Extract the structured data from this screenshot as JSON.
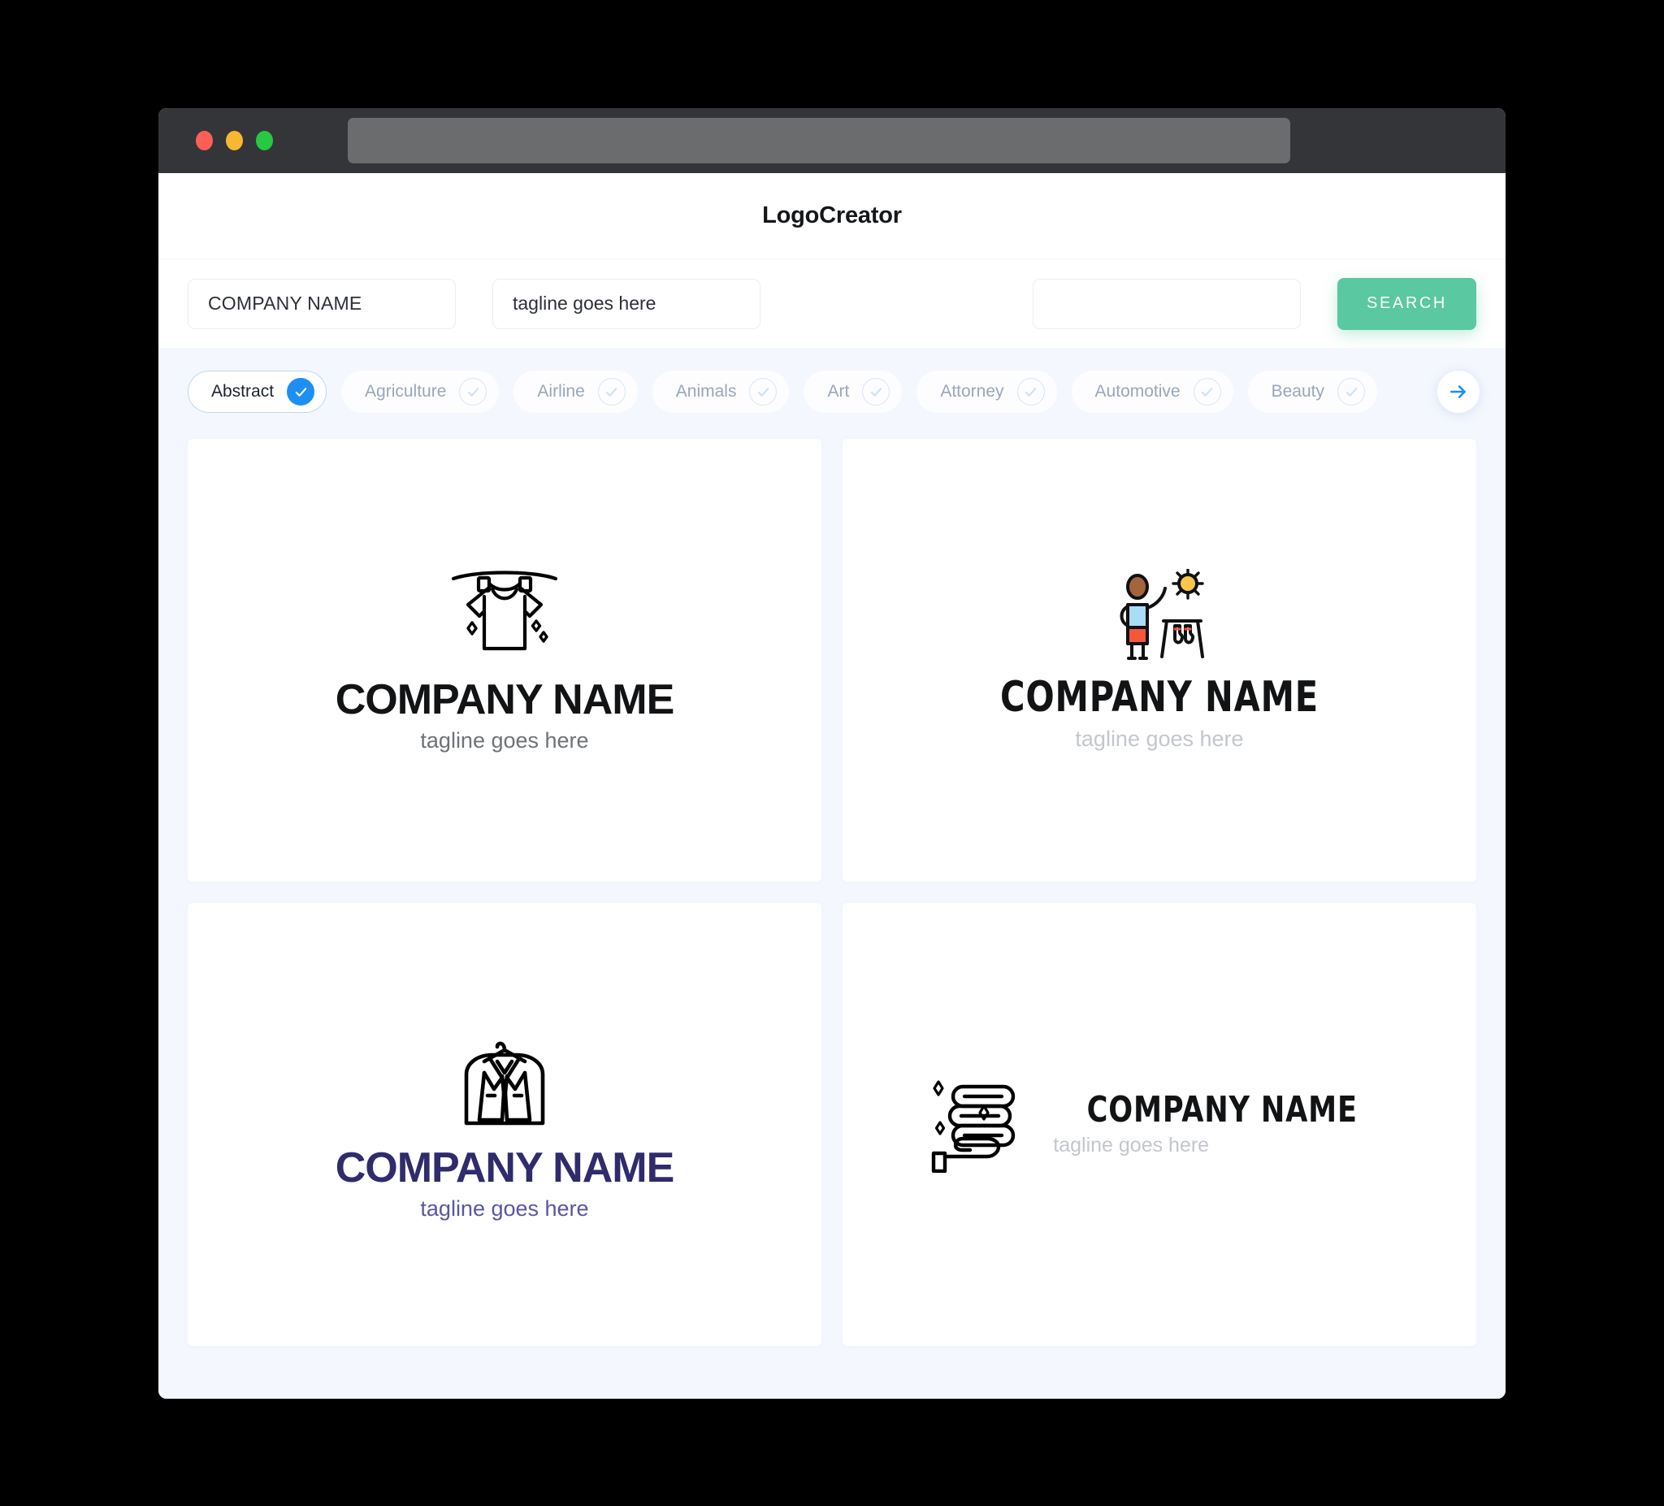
{
  "window": {
    "traffic_lights": [
      "close",
      "minimize",
      "maximize"
    ],
    "url_value": ""
  },
  "header": {
    "app_title": "LogoCreator"
  },
  "search": {
    "company_value": "COMPANY NAME",
    "company_placeholder": "COMPANY NAME",
    "tagline_value": "tagline goes here",
    "tagline_placeholder": "tagline goes here",
    "extra_value": "",
    "extra_placeholder": "",
    "search_button": "SEARCH",
    "search_button_color": "#5ac8a0"
  },
  "categories": {
    "next_icon": "arrow-right-icon",
    "accent_color": "#1d8ff2",
    "items": [
      {
        "label": "Abstract",
        "selected": true
      },
      {
        "label": "Agriculture",
        "selected": false
      },
      {
        "label": "Airline",
        "selected": false
      },
      {
        "label": "Animals",
        "selected": false
      },
      {
        "label": "Art",
        "selected": false
      },
      {
        "label": "Attorney",
        "selected": false
      },
      {
        "label": "Automotive",
        "selected": false
      },
      {
        "label": "Beauty",
        "selected": false
      }
    ]
  },
  "results": {
    "cards": [
      {
        "icon": "tshirt-on-clothesline-icon",
        "name": "COMPANY NAME",
        "tagline": "tagline goes here",
        "name_color": "#111315",
        "tagline_color": "#6e7378",
        "layout": "stacked"
      },
      {
        "icon": "person-sun-drying-rack-icon",
        "name": "COMPANY NAME",
        "tagline": "tagline goes here",
        "name_color": "#111315",
        "tagline_color": "#c3c7cc",
        "layout": "stacked-condensed"
      },
      {
        "icon": "suit-in-garment-bag-icon",
        "name": "COMPANY NAME",
        "tagline": "tagline goes here",
        "name_color": "#2f2b6d",
        "tagline_color": "#5a56a0",
        "layout": "stacked"
      },
      {
        "icon": "hand-holding-folded-towels-icon",
        "name": "COMPANY NAME",
        "tagline": "tagline goes here",
        "name_color": "#111315",
        "tagline_color": "#c3c7cc",
        "layout": "horizontal-condensed"
      }
    ]
  }
}
